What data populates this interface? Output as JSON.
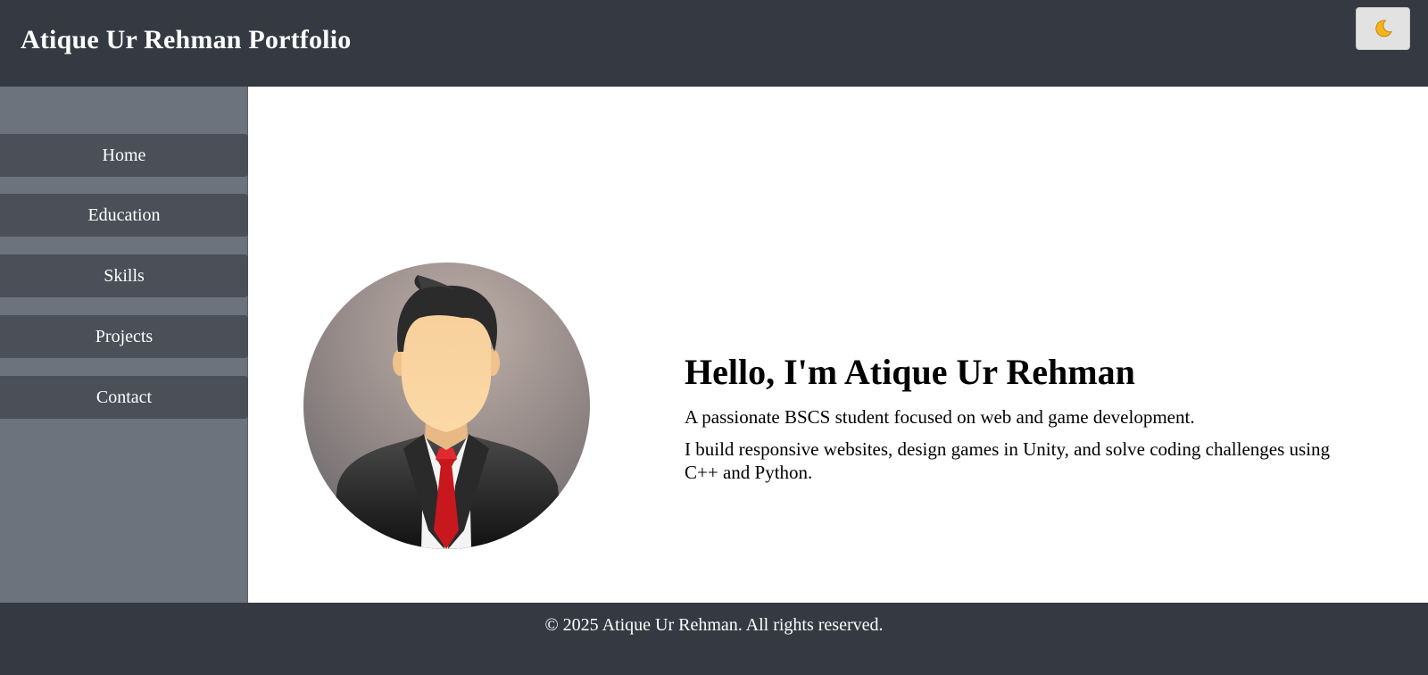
{
  "header": {
    "title": "Atique Ur Rehman Portfolio",
    "theme_toggle_icon": "moon-icon"
  },
  "sidebar": {
    "items": [
      {
        "label": "Home"
      },
      {
        "label": "Education"
      },
      {
        "label": "Skills"
      },
      {
        "label": "Projects"
      },
      {
        "label": "Contact"
      }
    ]
  },
  "main": {
    "heading": "Hello, I'm Atique Ur Rehman",
    "tagline": "A passionate BSCS student focused on web and game development.",
    "description": "I build responsive websites, design games in Unity, and solve coding challenges using C++ and Python."
  },
  "footer": {
    "text": "© 2025 Atique Ur Rehman. All rights reserved."
  },
  "colors": {
    "header_bg": "#353a42",
    "sidebar_bg": "#6c737d",
    "nav_item_bg": "#4a4f58",
    "tie": "#c8181e"
  }
}
